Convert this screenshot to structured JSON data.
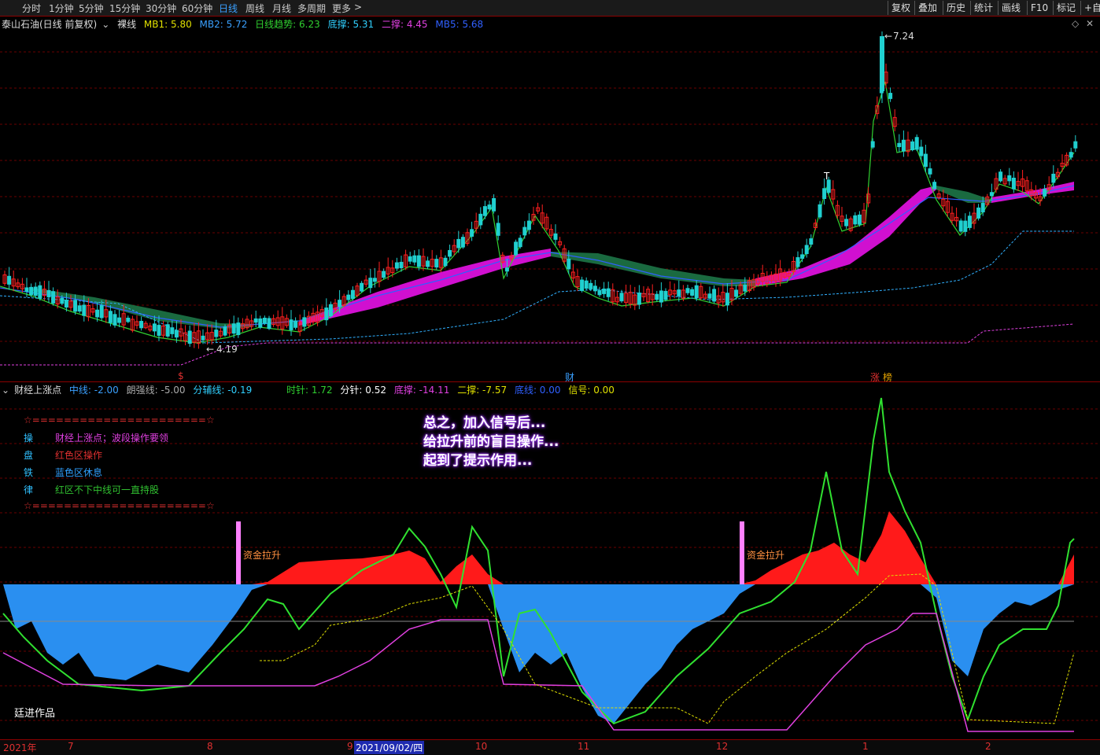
{
  "toolbar": {
    "periods": [
      "分时",
      "1分钟",
      "5分钟",
      "15分钟",
      "30分钟",
      "60分钟",
      "日线",
      "周线",
      "月线",
      "多周期",
      "更多"
    ],
    "more_chevron": ">",
    "tools": [
      "复权",
      "叠加",
      "历史",
      "统计",
      "画线",
      "F10",
      "标记",
      "+自选"
    ]
  },
  "main_panel": {
    "stock_title": "泰山石油(日线 前复权)",
    "chart_type": "裸线",
    "indicators": [
      {
        "name": "MB1",
        "value": "5.80",
        "color": "#e0e000"
      },
      {
        "name": "MB2",
        "value": "5.72",
        "color": "#3aa0ff"
      },
      {
        "name": "日线趋势",
        "value": "6.23",
        "color": "#30d030"
      },
      {
        "name": "底撑",
        "value": "5.31",
        "color": "#30d0ff"
      },
      {
        "name": "二撑",
        "value": "4.45",
        "color": "#e040e0"
      },
      {
        "name": "MB5",
        "value": "5.68",
        "color": "#3060ff"
      }
    ],
    "high_label": "7.24",
    "low_label": "4.19",
    "event_tags": [
      {
        "text": "$",
        "color": "#e03030"
      },
      {
        "text": "财",
        "color": "#3aa0ff"
      },
      {
        "text": "涨",
        "color": "#e03030"
      },
      {
        "text": "榜",
        "color": "#e0a000"
      }
    ],
    "marker_T": "T"
  },
  "sub_panel": {
    "title": "财经上涨点",
    "indicators": [
      {
        "name": "中线",
        "value": "-2.00",
        "color": "#3aa0ff"
      },
      {
        "name": "朗强线",
        "value": "-5.00",
        "color": "#aaaaaa"
      },
      {
        "name": "分辅线",
        "value": "-0.19",
        "color": "#30d0ff"
      },
      {
        "name": "时针",
        "value": "1.72",
        "color": "#30d030"
      },
      {
        "name": "分针",
        "value": "0.52",
        "color": "#ffffff"
      },
      {
        "name": "底撑",
        "value": "-14.11",
        "color": "#e040e0"
      },
      {
        "name": "二撑",
        "value": "-7.57",
        "color": "#e0e000"
      },
      {
        "name": "底线",
        "value": "0.00",
        "color": "#3060ff"
      },
      {
        "name": "信号",
        "value": "0.00",
        "color": "#e0e000"
      }
    ],
    "legend_border": "☆======================☆",
    "legend_rows": [
      {
        "key": "操",
        "text": "财经上涨点；波段操作要领",
        "color": "#e040e0"
      },
      {
        "key": "盘",
        "text": "红色区操作",
        "color": "#e03030"
      },
      {
        "key": "铁",
        "text": "蓝色区休息",
        "color": "#30a0ff"
      },
      {
        "key": "律",
        "text": "红区不下中线可一直持股",
        "color": "#30c030"
      }
    ],
    "signal_label": "资金拉升",
    "author": "廷进作品",
    "annotation": [
      "总之，加入信号后...",
      "给拉升前的盲目操作...",
      "起到了提示作用..."
    ]
  },
  "timeline": {
    "labels": [
      "2021年",
      "7",
      "8",
      "9",
      "10",
      "11",
      "12",
      "1",
      "2"
    ],
    "selected_date": "2021/09/02/四"
  },
  "colors": {
    "up": "#ff2020",
    "down": "#20d0d0",
    "magenta": "#d010d0",
    "green_band": "#1a6a40",
    "grid": "#8b0000",
    "blue_fill": "#2a8ff0"
  }
}
